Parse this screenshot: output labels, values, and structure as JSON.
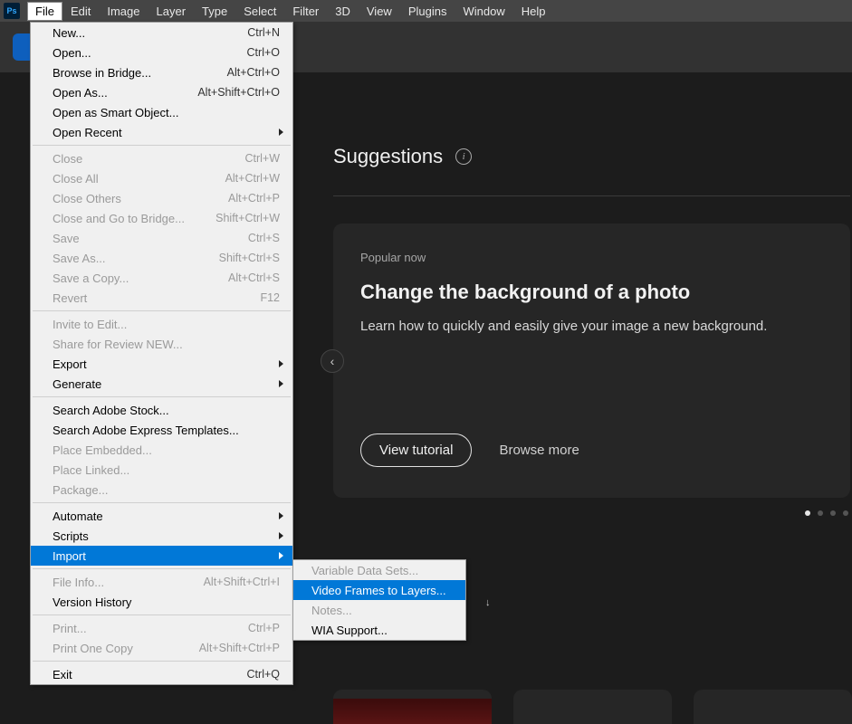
{
  "app_icon": "Ps",
  "menubar": [
    "File",
    "Edit",
    "Image",
    "Layer",
    "Type",
    "Select",
    "Filter",
    "3D",
    "View",
    "Plugins",
    "Window",
    "Help"
  ],
  "file_menu": {
    "groups": [
      [
        {
          "label": "New...",
          "shortcut": "Ctrl+N",
          "enabled": true
        },
        {
          "label": "Open...",
          "shortcut": "Ctrl+O",
          "enabled": true
        },
        {
          "label": "Browse in Bridge...",
          "shortcut": "Alt+Ctrl+O",
          "enabled": true
        },
        {
          "label": "Open As...",
          "shortcut": "Alt+Shift+Ctrl+O",
          "enabled": true
        },
        {
          "label": "Open as Smart Object...",
          "shortcut": "",
          "enabled": true
        },
        {
          "label": "Open Recent",
          "shortcut": "",
          "enabled": true,
          "submenu": true
        }
      ],
      [
        {
          "label": "Close",
          "shortcut": "Ctrl+W",
          "enabled": false
        },
        {
          "label": "Close All",
          "shortcut": "Alt+Ctrl+W",
          "enabled": false
        },
        {
          "label": "Close Others",
          "shortcut": "Alt+Ctrl+P",
          "enabled": false
        },
        {
          "label": "Close and Go to Bridge...",
          "shortcut": "Shift+Ctrl+W",
          "enabled": false
        },
        {
          "label": "Save",
          "shortcut": "Ctrl+S",
          "enabled": false
        },
        {
          "label": "Save As...",
          "shortcut": "Shift+Ctrl+S",
          "enabled": false
        },
        {
          "label": "Save a Copy...",
          "shortcut": "Alt+Ctrl+S",
          "enabled": false
        },
        {
          "label": "Revert",
          "shortcut": "F12",
          "enabled": false
        }
      ],
      [
        {
          "label": "Invite to Edit...",
          "shortcut": "",
          "enabled": false
        },
        {
          "label": "Share for Review NEW...",
          "shortcut": "",
          "enabled": false
        },
        {
          "label": "Export",
          "shortcut": "",
          "enabled": true,
          "submenu": true
        },
        {
          "label": "Generate",
          "shortcut": "",
          "enabled": true,
          "submenu": true
        }
      ],
      [
        {
          "label": "Search Adobe Stock...",
          "shortcut": "",
          "enabled": true
        },
        {
          "label": "Search Adobe Express Templates...",
          "shortcut": "",
          "enabled": true
        },
        {
          "label": "Place Embedded...",
          "shortcut": "",
          "enabled": false
        },
        {
          "label": "Place Linked...",
          "shortcut": "",
          "enabled": false
        },
        {
          "label": "Package...",
          "shortcut": "",
          "enabled": false
        }
      ],
      [
        {
          "label": "Automate",
          "shortcut": "",
          "enabled": true,
          "submenu": true
        },
        {
          "label": "Scripts",
          "shortcut": "",
          "enabled": true,
          "submenu": true
        },
        {
          "label": "Import",
          "shortcut": "",
          "enabled": true,
          "submenu": true,
          "highlight": true
        }
      ],
      [
        {
          "label": "File Info...",
          "shortcut": "Alt+Shift+Ctrl+I",
          "enabled": false
        },
        {
          "label": "Version History",
          "shortcut": "",
          "enabled": true
        }
      ],
      [
        {
          "label": "Print...",
          "shortcut": "Ctrl+P",
          "enabled": false
        },
        {
          "label": "Print One Copy",
          "shortcut": "Alt+Shift+Ctrl+P",
          "enabled": false
        }
      ],
      [
        {
          "label": "Exit",
          "shortcut": "Ctrl+Q",
          "enabled": true
        }
      ]
    ]
  },
  "import_submenu": [
    {
      "label": "Variable Data Sets...",
      "enabled": false
    },
    {
      "label": "Video Frames to Layers...",
      "enabled": true,
      "highlight": true
    },
    {
      "label": "Notes...",
      "enabled": false
    },
    {
      "label": "WIA Support...",
      "enabled": true
    }
  ],
  "suggestions": {
    "title": "Suggestions",
    "card": {
      "tag": "Popular now",
      "title": "Change the background of a photo",
      "desc": "Learn how to quickly and easily give your image a new background.",
      "cta": "View tutorial",
      "more": "Browse more"
    },
    "prev_glyph": "‹"
  },
  "sort_arrow": "↓"
}
